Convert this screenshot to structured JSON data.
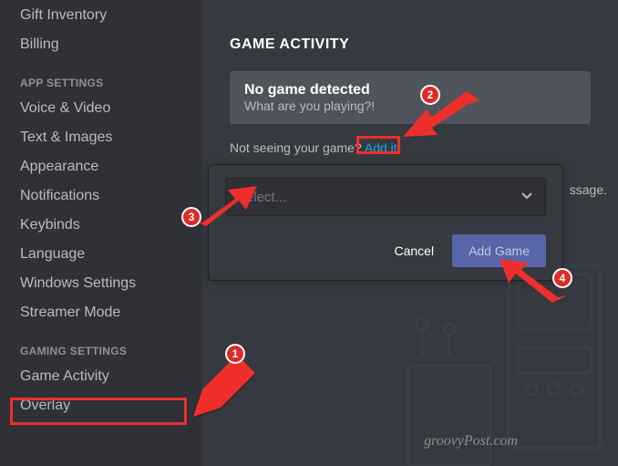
{
  "sidebar": {
    "items_top": [
      "Gift Inventory",
      "Billing"
    ],
    "app_header": "APP SETTINGS",
    "items_app": [
      "Voice & Video",
      "Text & Images",
      "Appearance",
      "Notifications",
      "Keybinds",
      "Language",
      "Windows Settings",
      "Streamer Mode"
    ],
    "gaming_header": "GAMING SETTINGS",
    "items_gaming": [
      "Game Activity",
      "Overlay"
    ]
  },
  "content": {
    "title": "GAME ACTIVITY",
    "status_line1": "No game detected",
    "status_line2": "What are you playing?!",
    "hint_pre": "Not seeing your game? ",
    "hint_link": "Add it!",
    "select_placeholder": "Select...",
    "cancel": "Cancel",
    "add_game": "Add Game",
    "msg_fragment": "ssage.",
    "watermark": "groovyPost.com"
  },
  "annotations": {
    "b1": "1",
    "b2": "2",
    "b3": "3",
    "b4": "4"
  }
}
